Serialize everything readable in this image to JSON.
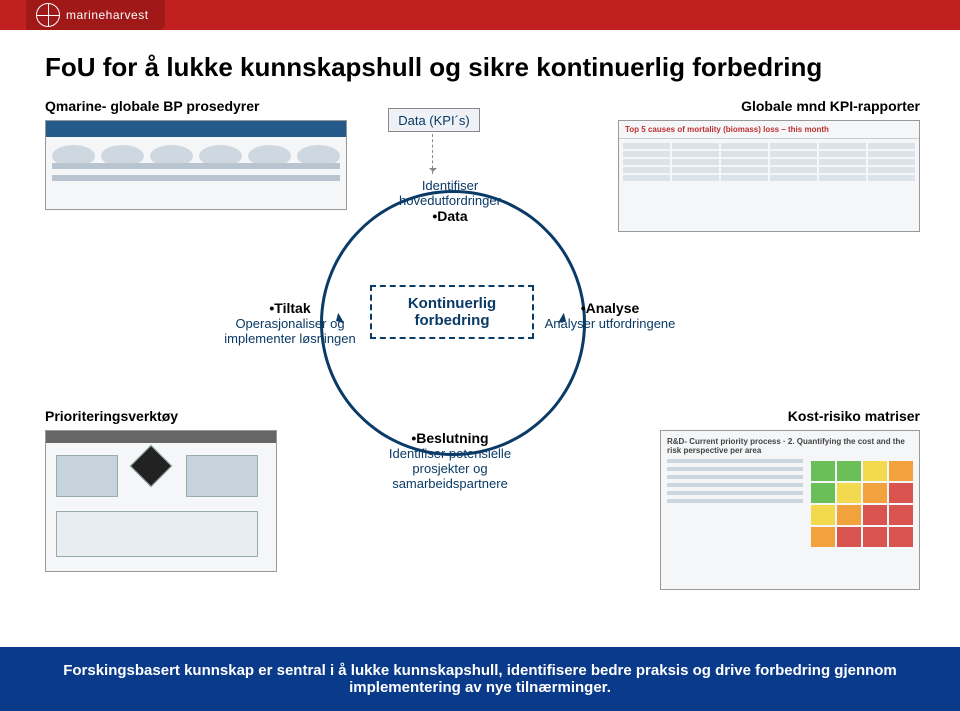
{
  "brand": "marineharvest",
  "title": "FoU for å lukke kunnskapshull og sikre kontinuerlig forbedring",
  "labels": {
    "top_left": "Qmarine- globale BP prosedyrer",
    "top_right": "Globale mnd KPI-rapporter",
    "bottom_left": "Prioriteringsverktøy",
    "bottom_right": "Kost-risiko matriser"
  },
  "data_box": "Data (KPI´s)",
  "cycle": {
    "center": "Kontinuerlig forbedring",
    "top": {
      "line1": "Identifiser hovedutfordringer",
      "bullet": "•Data"
    },
    "right": {
      "title": "•Analyse",
      "line1": "Analyser utfordringene"
    },
    "bottom": {
      "title": "•Beslutning",
      "line1": "Identifiser potensielle prosjekter og samarbeidspartnere"
    },
    "left": {
      "title": "•Tiltak",
      "line1": "Operasjonaliser og implementer løsningen"
    }
  },
  "thumbnails": {
    "tr_title": "Top 5 causes of mortality (biomass) loss – this month",
    "br_title": "R&D- Current priority process · 2. Quantifying the cost and the risk perspective per area"
  },
  "footer": "Forskingsbasert kunnskap er sentral i å lukke kunnskapshull, identifisere bedre praksis og drive forbedring gjennom implementering av nye tilnærminger."
}
